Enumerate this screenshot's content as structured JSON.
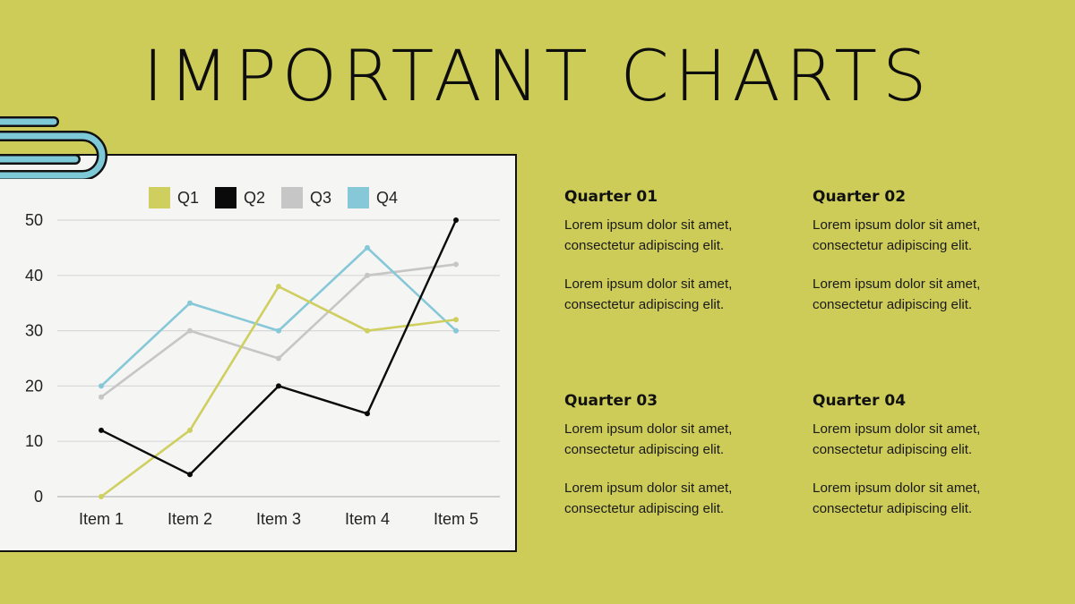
{
  "title": "IMPORTANT CHARTS",
  "colors": {
    "background": "#cdcc58",
    "panel": "#f5f5f4",
    "clip": "#7ec9d8"
  },
  "chart_data": {
    "type": "line",
    "title": "",
    "xlabel": "",
    "ylabel": "",
    "categories": [
      "Item 1",
      "Item 2",
      "Item 3",
      "Item 4",
      "Item 5"
    ],
    "ylim": [
      0,
      50
    ],
    "yticks": [
      0,
      10,
      20,
      30,
      40,
      50
    ],
    "grid": true,
    "legend_position": "top",
    "series": [
      {
        "name": "Q1",
        "color": "#cfcf60",
        "values": [
          0,
          12,
          38,
          30,
          32
        ]
      },
      {
        "name": "Q2",
        "color": "#0a0a0a",
        "values": [
          12,
          4,
          20,
          15,
          50
        ]
      },
      {
        "name": "Q3",
        "color": "#c6c6c6",
        "values": [
          18,
          30,
          25,
          40,
          42
        ]
      },
      {
        "name": "Q4",
        "color": "#86c8d8",
        "values": [
          20,
          35,
          30,
          45,
          30
        ]
      }
    ]
  },
  "quarters": [
    {
      "heading": "Quarter 01",
      "para1": "Lorem ipsum dolor sit amet, consectetur adipiscing elit.",
      "para2": "Lorem ipsum dolor sit amet, consectetur adipiscing elit."
    },
    {
      "heading": "Quarter 02",
      "para1": "Lorem ipsum dolor sit amet, consectetur adipiscing elit.",
      "para2": "Lorem ipsum dolor sit amet, consectetur adipiscing elit."
    },
    {
      "heading": "Quarter 03",
      "para1": "Lorem ipsum dolor sit amet, consectetur adipiscing elit.",
      "para2": "Lorem ipsum dolor sit amet, consectetur adipiscing elit."
    },
    {
      "heading": "Quarter 04",
      "para1": "Lorem ipsum dolor sit amet, consectetur adipiscing elit.",
      "para2": "Lorem ipsum dolor sit amet, consectetur adipiscing elit."
    }
  ]
}
